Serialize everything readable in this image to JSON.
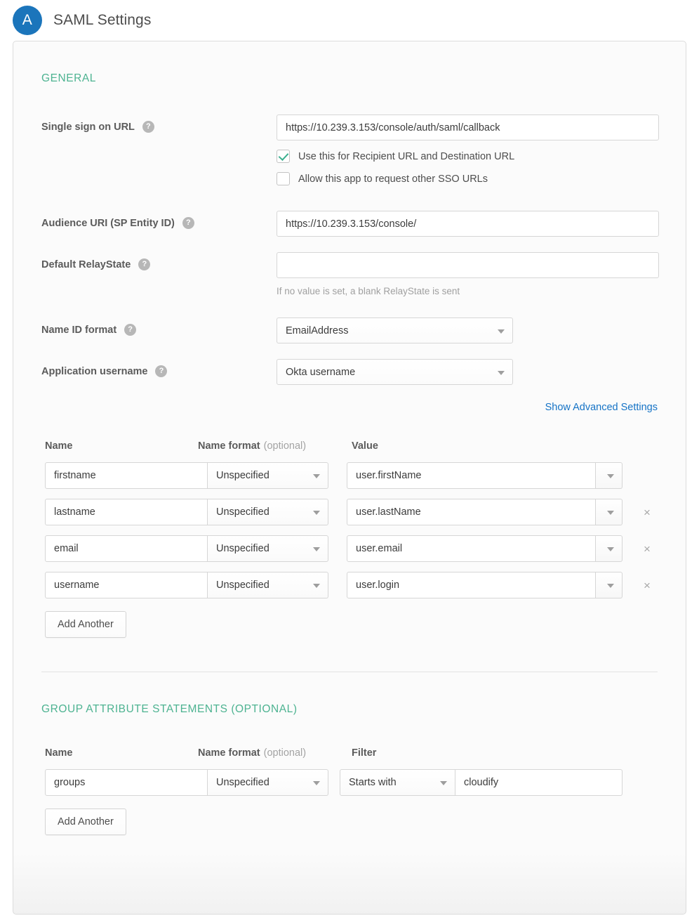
{
  "header": {
    "avatar_letter": "A",
    "title": "SAML Settings"
  },
  "general": {
    "heading": "GENERAL",
    "fields": {
      "sso_url": {
        "label": "Single sign on URL",
        "help": "?",
        "value": "https://10.239.3.153/console/auth/saml/callback"
      },
      "checkbox_recipient": {
        "label": "Use this for Recipient URL and Destination URL",
        "checked": true
      },
      "checkbox_other_sso": {
        "label": "Allow this app to request other SSO URLs",
        "checked": false
      },
      "audience_uri": {
        "label": "Audience URI (SP Entity ID)",
        "help": "?",
        "value": "https://10.239.3.153/console/"
      },
      "relay_state": {
        "label": "Default RelayState",
        "help": "?",
        "value": "",
        "placeholder": "",
        "hint": "If no value is set, a blank RelayState is sent"
      },
      "name_id_format": {
        "label": "Name ID format",
        "help": "?",
        "value": "EmailAddress"
      },
      "application_username": {
        "label": "Application username",
        "help": "?",
        "value": "Okta username"
      }
    },
    "advanced_link": "Show Advanced Settings"
  },
  "attribute_statements": {
    "columns": {
      "name": "Name",
      "name_format": "Name format",
      "optional": "(optional)",
      "value": "Value"
    },
    "rows": [
      {
        "name": "firstname",
        "format": "Unspecified",
        "value": "user.firstName",
        "removable": false
      },
      {
        "name": "lastname",
        "format": "Unspecified",
        "value": "user.lastName",
        "removable": true
      },
      {
        "name": "email",
        "format": "Unspecified",
        "value": "user.email",
        "removable": true
      },
      {
        "name": "username",
        "format": "Unspecified",
        "value": "user.login",
        "removable": true
      }
    ],
    "add_another": "Add Another",
    "remove_glyph": "×"
  },
  "group_attribute_statements": {
    "heading": "GROUP ATTRIBUTE STATEMENTS (OPTIONAL)",
    "columns": {
      "name": "Name",
      "name_format": "Name format",
      "optional": "(optional)",
      "filter": "Filter"
    },
    "rows": [
      {
        "name": "groups",
        "format": "Unspecified",
        "filter_op": "Starts with",
        "filter_value": "cloudify"
      }
    ],
    "add_another": "Add Another"
  },
  "colors": {
    "accent_green": "#4db391",
    "link_blue": "#1573c6",
    "avatar_blue": "#1b75bb",
    "check_green": "#3bb08f",
    "label_gray": "#5b5b5b",
    "hint_gray": "#a0a0a0"
  }
}
